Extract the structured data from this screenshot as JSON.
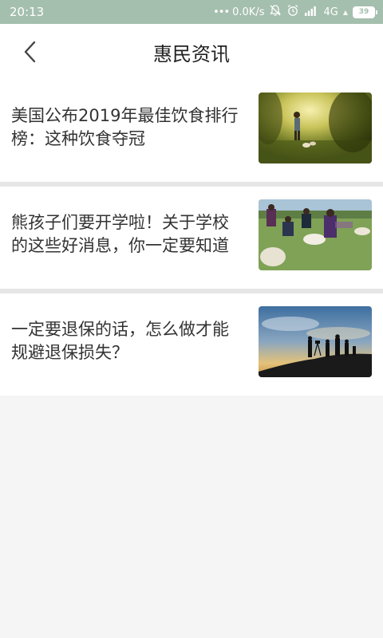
{
  "status_bar": {
    "time": "20:13",
    "network_speed": "0.0K/s",
    "network_type": "4G",
    "battery_level": "39",
    "icons": [
      "more-dots-icon",
      "mute-icon",
      "alarm-icon",
      "signal-icon",
      "wifi-icon",
      "battery-icon"
    ]
  },
  "header": {
    "title": "惠民资讯",
    "back_icon": "chevron-left-icon"
  },
  "news": [
    {
      "title": "美国公布2019年最佳饮食排行榜：这种饮食夺冠",
      "thumbnail": "sunlit-garden-photo"
    },
    {
      "title": "熊孩子们要开学啦！关于学校的这些好消息，你一定要知道",
      "thumbnail": "sheep-shearing-photo"
    },
    {
      "title": "一定要退保的话，怎么做才能规避退保损失？",
      "thumbnail": "silhouette-hill-sunset-photo"
    }
  ],
  "colors": {
    "status_bar_bg": "#a5bfae",
    "page_bg": "#f5f5f5",
    "card_bg": "#ffffff",
    "divider": "#e6e6e6",
    "title_text": "#333333"
  }
}
